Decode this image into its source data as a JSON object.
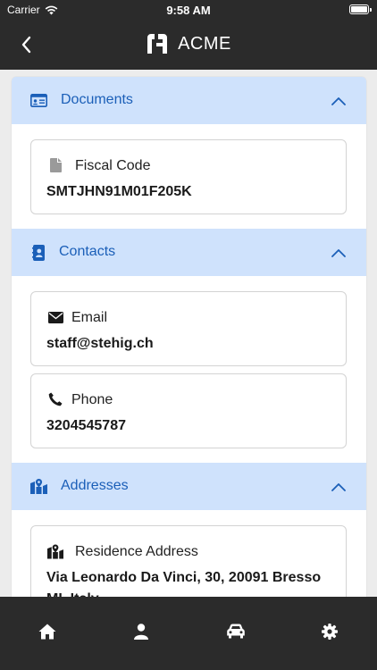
{
  "status_bar": {
    "carrier": "Carrier",
    "time": "9:58 AM"
  },
  "header": {
    "title": "ACME",
    "back_icon": "chevron-left-icon",
    "logo_icon": "acme-logo-icon"
  },
  "sections": {
    "documents": {
      "title": "Documents",
      "icon": "id-card-icon",
      "fields": [
        {
          "label": "Fiscal Code",
          "value": "SMTJHN91M01F205K",
          "icon": "file-icon"
        }
      ]
    },
    "contacts": {
      "title": "Contacts",
      "icon": "address-book-icon",
      "fields": [
        {
          "label": "Email",
          "value": "staff@stehig.ch",
          "icon": "envelope-icon"
        },
        {
          "label": "Phone",
          "value": "3204545787",
          "icon": "phone-icon"
        }
      ]
    },
    "addresses": {
      "title": "Addresses",
      "icon": "map-icon",
      "fields": [
        {
          "label": "Residence Address",
          "value_line1": "Via Leonardo Da Vinci, 30, 20091 Bresso",
          "value_line2": "MI, Italy",
          "icon": "map-icon"
        }
      ]
    }
  },
  "tab_bar": {
    "tabs": [
      {
        "icon": "home-icon"
      },
      {
        "icon": "user-icon"
      },
      {
        "icon": "car-icon"
      },
      {
        "icon": "gear-icon"
      }
    ]
  },
  "colors": {
    "bar_background": "#2b2b2b",
    "section_header": "#cfe2fc",
    "accent": "#1b5fb8",
    "page_background": "#ececec"
  }
}
